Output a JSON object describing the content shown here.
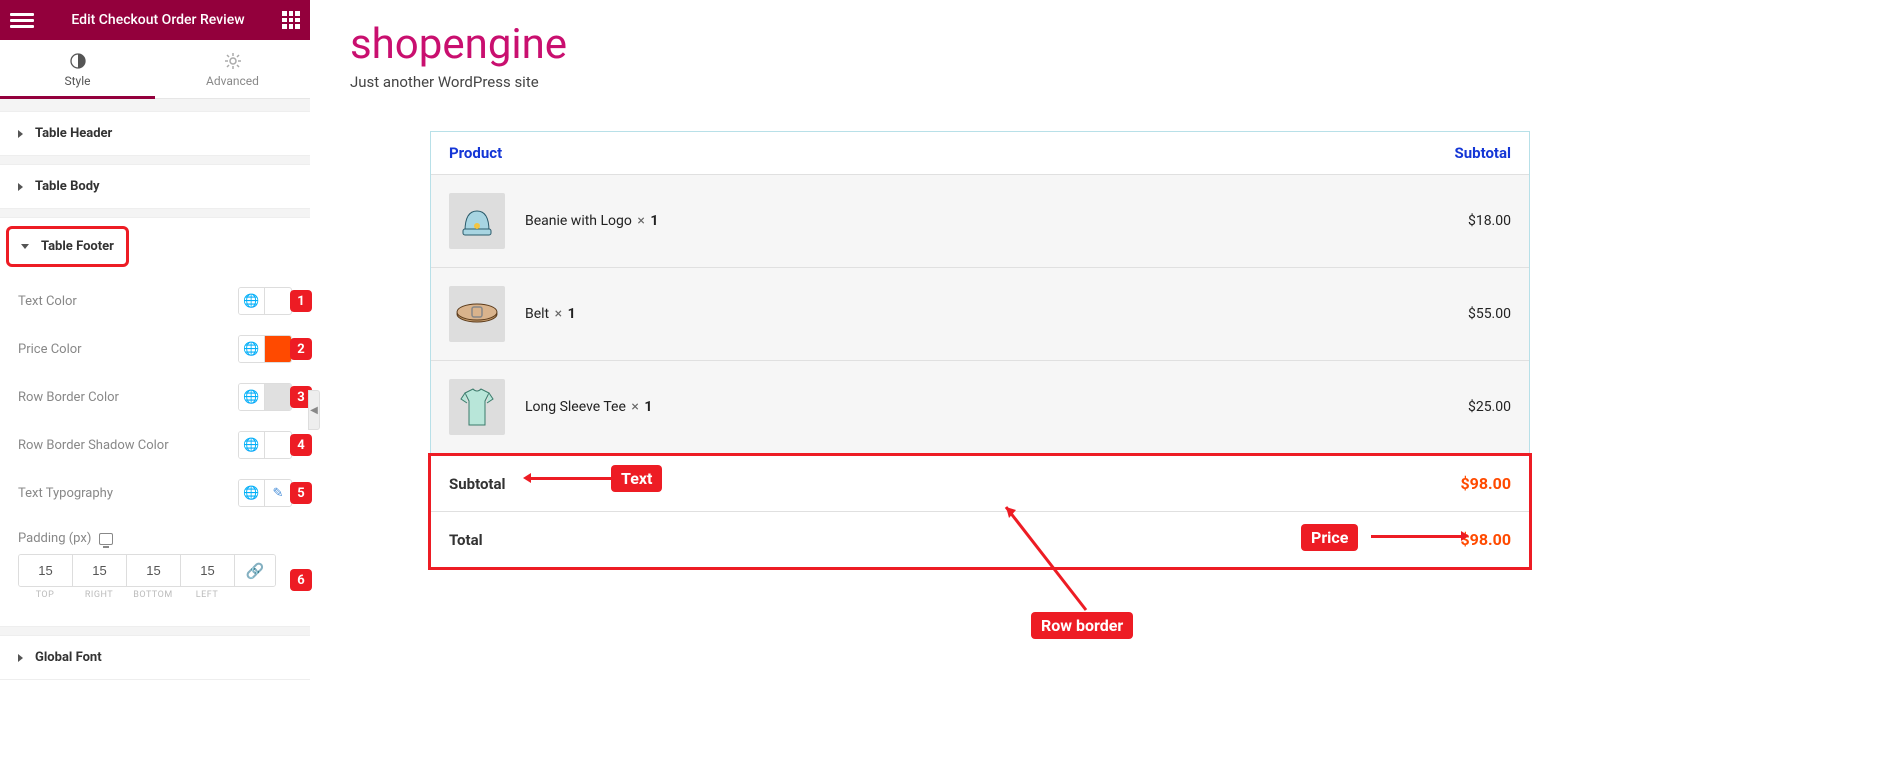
{
  "header": {
    "title": "Edit Checkout Order Review"
  },
  "tabs": {
    "style": "Style",
    "advanced": "Advanced"
  },
  "sections": {
    "table_header": "Table Header",
    "table_body": "Table Body",
    "table_footer": "Table Footer",
    "global_font": "Global Font"
  },
  "footer_controls": {
    "text_color": {
      "label": "Text Color",
      "value": "#3a3a3a"
    },
    "price_color": {
      "label": "Price Color",
      "value": "#ff4a00"
    },
    "row_border_color": {
      "label": "Row Border Color",
      "value": "#e0e0e0"
    },
    "row_border_shadow": {
      "label": "Row Border Shadow Color",
      "value": "#ffffff"
    },
    "text_typography": {
      "label": "Text Typography"
    },
    "padding": {
      "label": "Padding (px)",
      "top": "15",
      "right": "15",
      "bottom": "15",
      "left": "15",
      "sub": {
        "top": "TOP",
        "right": "RIGHT",
        "bottom": "BOTTOM",
        "left": "LEFT"
      }
    }
  },
  "badges": {
    "b1": "1",
    "b2": "2",
    "b3": "3",
    "b4": "4",
    "b5": "5",
    "b6": "6"
  },
  "site": {
    "title": "shopengine",
    "tag": "Just another WordPress site"
  },
  "order": {
    "head": {
      "product": "Product",
      "subtotal": "Subtotal"
    },
    "rows": [
      {
        "name": "Beanie with Logo",
        "qty": "1",
        "price": "$18.00"
      },
      {
        "name": "Belt",
        "qty": "1",
        "price": "$55.00"
      },
      {
        "name": "Long Sleeve Tee",
        "qty": "1",
        "price": "$25.00"
      }
    ],
    "footer": {
      "subtotal_label": "Subtotal",
      "subtotal_price": "$98.00",
      "total_label": "Total",
      "total_price": "$98.00"
    }
  },
  "annotations": {
    "text": "Text",
    "price": "Price",
    "row_border": "Row border"
  },
  "glyphs": {
    "times": "×",
    "globe": "🌐",
    "link": "🔗",
    "pencil": "✎"
  }
}
